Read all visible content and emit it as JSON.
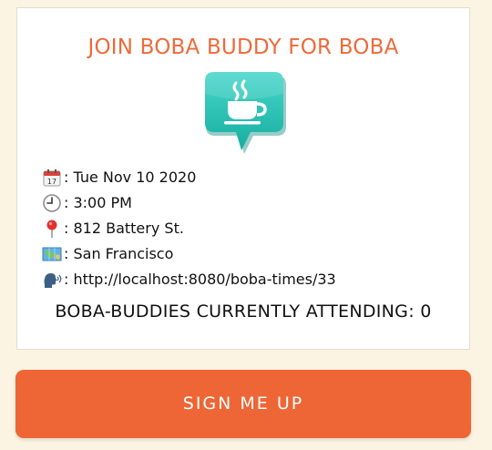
{
  "card": {
    "title": "JOIN BOBA BUDDY FOR BOBA",
    "logo_icon": "coffee-cup-speech-bubble-icon",
    "details": {
      "date_icon": "calendar-icon",
      "date": ": Tue Nov 10 2020",
      "time_icon": "clock-icon",
      "time": ": 3:00 PM",
      "address_icon": "pushpin-icon",
      "address": ": 812 Battery St.",
      "city_icon": "map-icon",
      "city": ": San Francisco",
      "link_icon": "speaking-head-icon",
      "link": ": http://localhost:8080/boba-times/33"
    },
    "attending_label": "BOBA-BUDDIES CURRENTLY ATTENDING: 0"
  },
  "signup_button_label": "SIGN ME UP",
  "colors": {
    "background": "#fbf4e3",
    "accent": "#ee6636",
    "logo_teal": "#22c1b5"
  }
}
